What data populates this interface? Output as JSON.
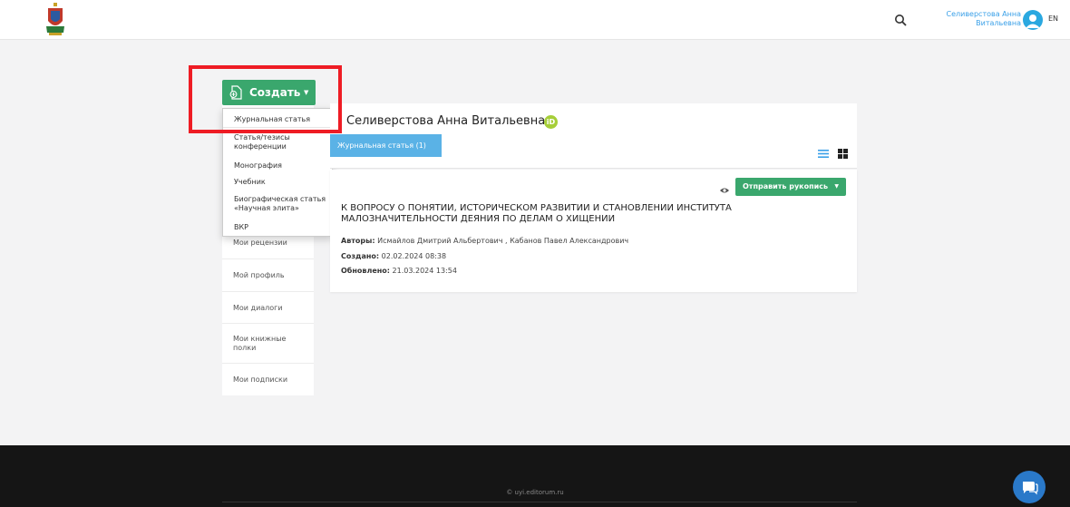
{
  "header": {
    "logo_icon": "crest-icon",
    "search_icon": "search-icon",
    "user_name": "Селиверстова Анна Витальевна",
    "lang": "EN"
  },
  "create": {
    "label": "Создать",
    "icon": "new-document-icon",
    "menu": [
      "Журнальная статья",
      "Статья/тезисы конференции",
      "Монография",
      "Учебник",
      "Биографическая статья «Научная элита»",
      "ВКР"
    ]
  },
  "sidebar": {
    "items": [
      "Мои рецензии",
      "Мой профиль",
      "Мои диалоги",
      "Мои книжные полки",
      "Мои подписки"
    ]
  },
  "profile": {
    "name": "Селиверстова Анна Витальевна",
    "orcid_label": "iD"
  },
  "tabs": {
    "active": "Журнальная статья (1)"
  },
  "article": {
    "send_label": "Отправить рукопись",
    "title": "К ВОПРОСУ О ПОНЯТИИ, ИСТОРИЧЕСКОМ РАЗВИТИИ И СТАНОВЛЕНИИ ИНСТИТУТА МАЛОЗНАЧИТЕЛЬНОСТИ ДЕЯНИЯ ПО ДЕЛАМ О ХИЩЕНИИ",
    "authors_label": "Авторы:",
    "authors": "Исмайлов Дмитрий Альбертович , Кабанов Павел Александрович",
    "created_label": "Создано:",
    "created": "02.02.2024 08:38",
    "updated_label": "Обновлено:",
    "updated": "21.03.2024 13:54"
  },
  "footer": {
    "copyright": "© uyi.editorum.ru"
  },
  "colors": {
    "green": "#3aa76d",
    "tab_blue": "#5ab2e6",
    "highlight_red": "#ee1c24",
    "footer": "#151515"
  }
}
